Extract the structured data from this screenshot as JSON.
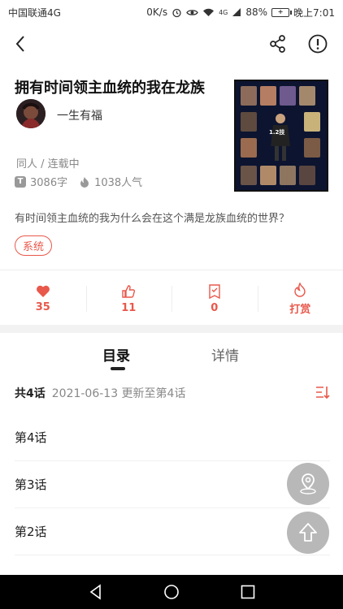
{
  "status_bar": {
    "carrier": "中国联通4G",
    "speed": "0K/s",
    "network": "4G",
    "battery": "88%",
    "time": "晚上7:01"
  },
  "book": {
    "title": "拥有时间领主血统的我在龙族",
    "author": "一生有福",
    "genre": "同人 / 连载中",
    "word_count": "3086字",
    "popularity": "1038人气",
    "summary": "有时间领主血统的我为什么会在这个满是龙族血统的世界？",
    "tag": "系统",
    "cover_text": "1.2技"
  },
  "actions": [
    {
      "icon": "heart-icon",
      "count": "35"
    },
    {
      "icon": "thumbs-up-icon",
      "count": "11"
    },
    {
      "icon": "ticket-icon",
      "count": "0"
    },
    {
      "icon": "fire-icon",
      "count": "打赏"
    }
  ],
  "tabs": {
    "catalog": "目录",
    "detail": "详情"
  },
  "chapters": {
    "count": "共4话",
    "update": "2021-06-13 更新至第4话",
    "items": [
      "第4话",
      "第3话",
      "第2话"
    ]
  },
  "colors": {
    "accent": "#e8584b",
    "fab": "#b8b8b8",
    "nav_bar": "#000000"
  }
}
